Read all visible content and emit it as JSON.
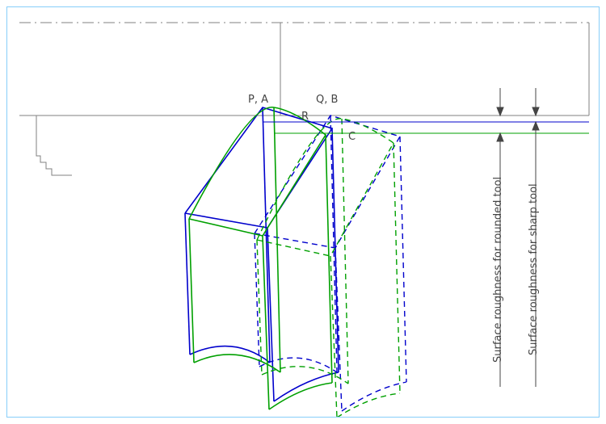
{
  "labels": {
    "PA": "P, A",
    "QB": "Q, B",
    "R": "R",
    "C": "C",
    "roundedTool": "Surface roughness for rounded tool",
    "sharpTool": "Surface roughness for sharp tool"
  },
  "colors": {
    "workpiece": "#808080",
    "sharpTool": "#0000cc",
    "roundedTool": "#00a000",
    "roughBlue": "#0000cc",
    "roughGreen": "#00a000",
    "frame": "#87cefa"
  }
}
